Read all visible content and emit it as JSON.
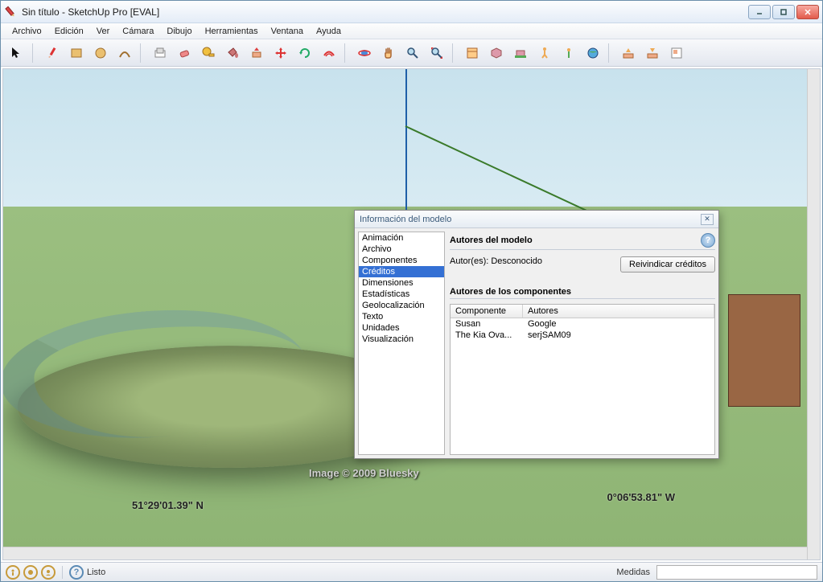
{
  "window": {
    "title": "Sin título - SketchUp Pro [EVAL]"
  },
  "menu": {
    "items": [
      "Archivo",
      "Edición",
      "Ver",
      "Cámara",
      "Dibujo",
      "Herramientas",
      "Ventana",
      "Ayuda"
    ]
  },
  "toolbar": {
    "groups": [
      [
        "select",
        "pencil",
        "rectangle",
        "circle",
        "arc"
      ],
      [
        "make-component",
        "eraser",
        "tape-measure",
        "paint-bucket",
        "push-pull",
        "move",
        "rotate",
        "offset",
        "follow-me"
      ],
      [
        "orbit",
        "pan",
        "zoom",
        "zoom-extents"
      ],
      [
        "outliner",
        "get-models",
        "position-camera",
        "walk",
        "look-around",
        "google-earth"
      ],
      [
        "download",
        "upload",
        "layout"
      ]
    ]
  },
  "viewport": {
    "watermark": "Image © 2009 Bluesky",
    "coord_left": "51°29'01.39\" N",
    "coord_right": "0°06'53.81\" W"
  },
  "dialog": {
    "title": "Información del modelo",
    "categories": [
      "Animación",
      "Archivo",
      "Componentes",
      "Créditos",
      "Dimensiones",
      "Estadísticas",
      "Geolocalización",
      "Texto",
      "Unidades",
      "Visualización"
    ],
    "selected_index": 3,
    "section1_title": "Autores del modelo",
    "authors_label": "Autor(es): Desconocido",
    "reclaim_btn": "Reivindicar créditos",
    "section2_title": "Autores de los componentes",
    "table": {
      "col1": "Componente",
      "col2": "Autores",
      "rows": [
        {
          "c": "Susan",
          "a": "Google"
        },
        {
          "c": "The Kia Ova...",
          "a": "serjSAM09"
        }
      ]
    }
  },
  "status": {
    "ready": "Listo",
    "measure_label": "Medidas"
  }
}
